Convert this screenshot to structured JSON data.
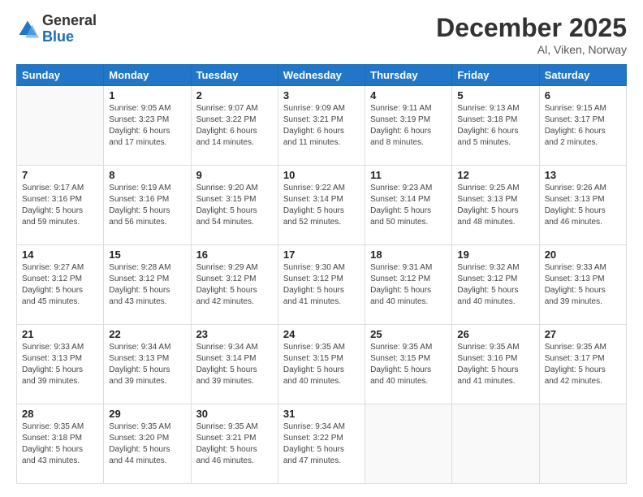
{
  "logo": {
    "general": "General",
    "blue": "Blue"
  },
  "title": "December 2025",
  "location": "Al, Viken, Norway",
  "days_of_week": [
    "Sunday",
    "Monday",
    "Tuesday",
    "Wednesday",
    "Thursday",
    "Friday",
    "Saturday"
  ],
  "weeks": [
    [
      {
        "day": "",
        "sunrise": "",
        "sunset": "",
        "daylight": ""
      },
      {
        "day": "1",
        "sunrise": "Sunrise: 9:05 AM",
        "sunset": "Sunset: 3:23 PM",
        "daylight": "Daylight: 6 hours and 17 minutes."
      },
      {
        "day": "2",
        "sunrise": "Sunrise: 9:07 AM",
        "sunset": "Sunset: 3:22 PM",
        "daylight": "Daylight: 6 hours and 14 minutes."
      },
      {
        "day": "3",
        "sunrise": "Sunrise: 9:09 AM",
        "sunset": "Sunset: 3:21 PM",
        "daylight": "Daylight: 6 hours and 11 minutes."
      },
      {
        "day": "4",
        "sunrise": "Sunrise: 9:11 AM",
        "sunset": "Sunset: 3:19 PM",
        "daylight": "Daylight: 6 hours and 8 minutes."
      },
      {
        "day": "5",
        "sunrise": "Sunrise: 9:13 AM",
        "sunset": "Sunset: 3:18 PM",
        "daylight": "Daylight: 6 hours and 5 minutes."
      },
      {
        "day": "6",
        "sunrise": "Sunrise: 9:15 AM",
        "sunset": "Sunset: 3:17 PM",
        "daylight": "Daylight: 6 hours and 2 minutes."
      }
    ],
    [
      {
        "day": "7",
        "sunrise": "Sunrise: 9:17 AM",
        "sunset": "Sunset: 3:16 PM",
        "daylight": "Daylight: 5 hours and 59 minutes."
      },
      {
        "day": "8",
        "sunrise": "Sunrise: 9:19 AM",
        "sunset": "Sunset: 3:16 PM",
        "daylight": "Daylight: 5 hours and 56 minutes."
      },
      {
        "day": "9",
        "sunrise": "Sunrise: 9:20 AM",
        "sunset": "Sunset: 3:15 PM",
        "daylight": "Daylight: 5 hours and 54 minutes."
      },
      {
        "day": "10",
        "sunrise": "Sunrise: 9:22 AM",
        "sunset": "Sunset: 3:14 PM",
        "daylight": "Daylight: 5 hours and 52 minutes."
      },
      {
        "day": "11",
        "sunrise": "Sunrise: 9:23 AM",
        "sunset": "Sunset: 3:14 PM",
        "daylight": "Daylight: 5 hours and 50 minutes."
      },
      {
        "day": "12",
        "sunrise": "Sunrise: 9:25 AM",
        "sunset": "Sunset: 3:13 PM",
        "daylight": "Daylight: 5 hours and 48 minutes."
      },
      {
        "day": "13",
        "sunrise": "Sunrise: 9:26 AM",
        "sunset": "Sunset: 3:13 PM",
        "daylight": "Daylight: 5 hours and 46 minutes."
      }
    ],
    [
      {
        "day": "14",
        "sunrise": "Sunrise: 9:27 AM",
        "sunset": "Sunset: 3:12 PM",
        "daylight": "Daylight: 5 hours and 45 minutes."
      },
      {
        "day": "15",
        "sunrise": "Sunrise: 9:28 AM",
        "sunset": "Sunset: 3:12 PM",
        "daylight": "Daylight: 5 hours and 43 minutes."
      },
      {
        "day": "16",
        "sunrise": "Sunrise: 9:29 AM",
        "sunset": "Sunset: 3:12 PM",
        "daylight": "Daylight: 5 hours and 42 minutes."
      },
      {
        "day": "17",
        "sunrise": "Sunrise: 9:30 AM",
        "sunset": "Sunset: 3:12 PM",
        "daylight": "Daylight: 5 hours and 41 minutes."
      },
      {
        "day": "18",
        "sunrise": "Sunrise: 9:31 AM",
        "sunset": "Sunset: 3:12 PM",
        "daylight": "Daylight: 5 hours and 40 minutes."
      },
      {
        "day": "19",
        "sunrise": "Sunrise: 9:32 AM",
        "sunset": "Sunset: 3:12 PM",
        "daylight": "Daylight: 5 hours and 40 minutes."
      },
      {
        "day": "20",
        "sunrise": "Sunrise: 9:33 AM",
        "sunset": "Sunset: 3:13 PM",
        "daylight": "Daylight: 5 hours and 39 minutes."
      }
    ],
    [
      {
        "day": "21",
        "sunrise": "Sunrise: 9:33 AM",
        "sunset": "Sunset: 3:13 PM",
        "daylight": "Daylight: 5 hours and 39 minutes."
      },
      {
        "day": "22",
        "sunrise": "Sunrise: 9:34 AM",
        "sunset": "Sunset: 3:13 PM",
        "daylight": "Daylight: 5 hours and 39 minutes."
      },
      {
        "day": "23",
        "sunrise": "Sunrise: 9:34 AM",
        "sunset": "Sunset: 3:14 PM",
        "daylight": "Daylight: 5 hours and 39 minutes."
      },
      {
        "day": "24",
        "sunrise": "Sunrise: 9:35 AM",
        "sunset": "Sunset: 3:15 PM",
        "daylight": "Daylight: 5 hours and 40 minutes."
      },
      {
        "day": "25",
        "sunrise": "Sunrise: 9:35 AM",
        "sunset": "Sunset: 3:15 PM",
        "daylight": "Daylight: 5 hours and 40 minutes."
      },
      {
        "day": "26",
        "sunrise": "Sunrise: 9:35 AM",
        "sunset": "Sunset: 3:16 PM",
        "daylight": "Daylight: 5 hours and 41 minutes."
      },
      {
        "day": "27",
        "sunrise": "Sunrise: 9:35 AM",
        "sunset": "Sunset: 3:17 PM",
        "daylight": "Daylight: 5 hours and 42 minutes."
      }
    ],
    [
      {
        "day": "28",
        "sunrise": "Sunrise: 9:35 AM",
        "sunset": "Sunset: 3:18 PM",
        "daylight": "Daylight: 5 hours and 43 minutes."
      },
      {
        "day": "29",
        "sunrise": "Sunrise: 9:35 AM",
        "sunset": "Sunset: 3:20 PM",
        "daylight": "Daylight: 5 hours and 44 minutes."
      },
      {
        "day": "30",
        "sunrise": "Sunrise: 9:35 AM",
        "sunset": "Sunset: 3:21 PM",
        "daylight": "Daylight: 5 hours and 46 minutes."
      },
      {
        "day": "31",
        "sunrise": "Sunrise: 9:34 AM",
        "sunset": "Sunset: 3:22 PM",
        "daylight": "Daylight: 5 hours and 47 minutes."
      },
      {
        "day": "",
        "sunrise": "",
        "sunset": "",
        "daylight": ""
      },
      {
        "day": "",
        "sunrise": "",
        "sunset": "",
        "daylight": ""
      },
      {
        "day": "",
        "sunrise": "",
        "sunset": "",
        "daylight": ""
      }
    ]
  ]
}
